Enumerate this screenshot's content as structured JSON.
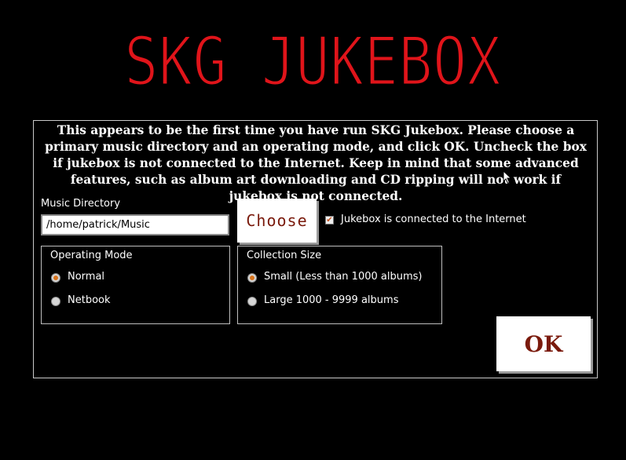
{
  "title": "SKG JUKEBOX",
  "intro": "This appears to be the first time you have run SKG Jukebox. Please choose a primary music directory and an operating mode, and click OK. Uncheck the box if jukebox is not connected to the Internet. Keep in mind that some advanced features, such as album art downloading and CD ripping will not work if jukebox is not connected.",
  "music_directory": {
    "label": "Music Directory",
    "value": "/home/patrick/Music"
  },
  "choose_button": "Choose",
  "internet_checkbox": {
    "label": "Jukebox is connected to the Internet",
    "checked": true
  },
  "operating_mode": {
    "title": "Operating Mode",
    "options": [
      "Normal",
      "Netbook"
    ],
    "selected": "Normal"
  },
  "collection_size": {
    "title": "Collection Size",
    "options": [
      "Small (Less than 1000 albums)",
      "Large 1000 - 9999 albums"
    ],
    "selected": "Small (Less than 1000 albums)"
  },
  "ok_button": "OK",
  "colors": {
    "background": "#000000",
    "title_red": "#e0141a",
    "button_text": "#7a1a0c",
    "radio_accent": "#d8731c"
  },
  "icons": [
    "checkmark-icon",
    "radio-selected-icon",
    "radio-unselected-icon",
    "mouse-cursor-icon"
  ]
}
